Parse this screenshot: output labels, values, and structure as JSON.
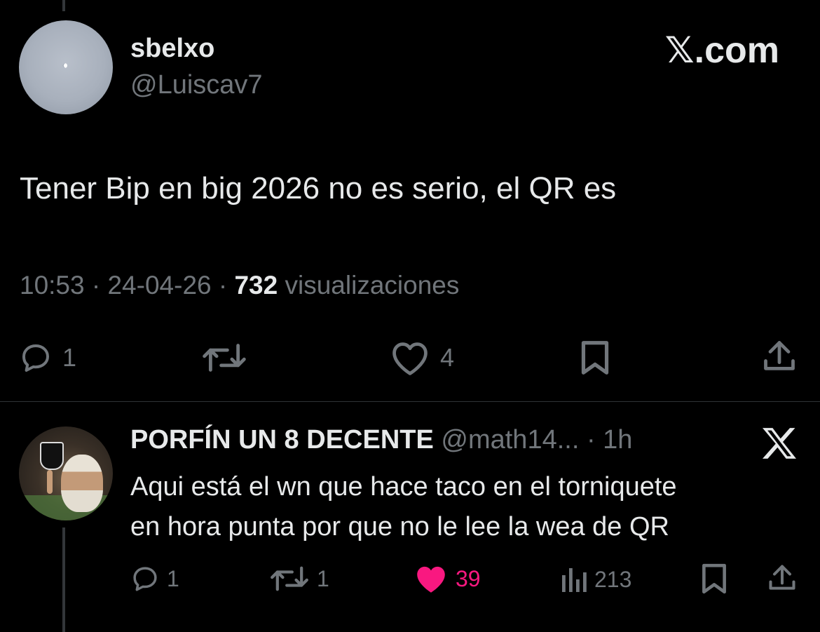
{
  "tweet": {
    "author": {
      "display_name": "sbelxo",
      "handle": "@Luiscav7"
    },
    "brand": "𝕏.com",
    "text": "Tener Bip en big 2026 no es serio, el QR es",
    "meta": {
      "time": "10:53",
      "sep1": " · ",
      "date": "24-04-26",
      "sep2": " · ",
      "views": "732",
      "views_label": " visualizaciones"
    },
    "actions": {
      "reply_count": "1",
      "like_count": "4"
    }
  },
  "reply": {
    "display_name": "PORFÍN UN 8 DECENTE",
    "handle": " @math14...",
    "time": " · 1h",
    "lines": [
      "Aqui está el wn que hace taco en el torniquete",
      "en hora punta por que no le lee la wea de QR"
    ],
    "actions": {
      "reply_count": "1",
      "retweet_count": "1",
      "like_count": "39",
      "views_count": "213"
    }
  },
  "colors": {
    "background": "#000000",
    "text": "#e7e9ea",
    "muted": "#71767b",
    "like": "#f91880",
    "divider": "#2f3336"
  },
  "icons": [
    "reply-icon",
    "retweet-icon",
    "like-icon",
    "bookmark-icon",
    "share-icon",
    "views-icon",
    "x-logo-icon"
  ]
}
